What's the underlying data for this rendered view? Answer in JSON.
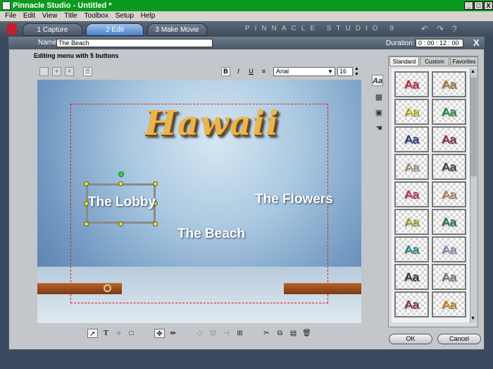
{
  "window": {
    "title": "Pinnacle Studio - Untitled *",
    "min": "_",
    "max": "□",
    "close": "X"
  },
  "menu": [
    "File",
    "Edit",
    "View",
    "Title",
    "Toolbox",
    "Setup",
    "Help"
  ],
  "main_tabs": [
    {
      "label": "1 Capture",
      "active": false
    },
    {
      "label": "2 Edit",
      "active": true
    },
    {
      "label": "3 Make Movie",
      "active": false
    }
  ],
  "brand": "PINNACLE STUDIO 9",
  "top_icons": [
    "undo-icon",
    "redo-icon",
    "help-icon"
  ],
  "editor": {
    "name_label": "Name:",
    "name_value": "The Beach",
    "duration_label": "Duration:",
    "duration_value": "0 : 00 : 12 : 00",
    "close": "X",
    "menu_header": "Editing menu with 5 buttons"
  },
  "font": {
    "family": "Arial",
    "size": "16"
  },
  "format_buttons": [
    "B",
    "I",
    "U",
    "≡"
  ],
  "canvas": {
    "title_text": "Hawaii",
    "buttons": [
      "The Lobby",
      "The Flowers",
      "The Beach"
    ]
  },
  "style_tabs": [
    {
      "label": "Standard",
      "active": true
    },
    {
      "label": "Custom",
      "active": false
    },
    {
      "label": "Favorites",
      "active": false
    }
  ],
  "swatches": [
    {
      "text": "Aa",
      "color": "#e02040"
    },
    {
      "text": "Aa",
      "color": "#c08a40"
    },
    {
      "text": "Aa",
      "color": "#e8e020"
    },
    {
      "text": "Aa",
      "color": "#20a040"
    },
    {
      "text": "Aa",
      "color": "#1a3a8a"
    },
    {
      "text": "Aa",
      "color": "#a02060"
    },
    {
      "text": "Aa",
      "color": "#d0b8a0"
    },
    {
      "text": "Aa",
      "color": "#404040"
    },
    {
      "text": "Aa",
      "color": "#e03060"
    },
    {
      "text": "Aa",
      "color": "#e0a070"
    },
    {
      "text": "Aa",
      "color": "#c8c830"
    },
    {
      "text": "Aa",
      "color": "#208040"
    },
    {
      "text": "Aa",
      "color": "#20a0a0"
    },
    {
      "text": "Aa",
      "color": "#c0a0e0"
    },
    {
      "text": "Aa",
      "color": "#303030"
    },
    {
      "text": "Aa",
      "color": "#909090"
    },
    {
      "text": "Aa",
      "color": "#a03050"
    },
    {
      "text": "Aa",
      "color": "#f0a020"
    }
  ],
  "footer": {
    "ok": "OK",
    "cancel": "Cancel"
  }
}
